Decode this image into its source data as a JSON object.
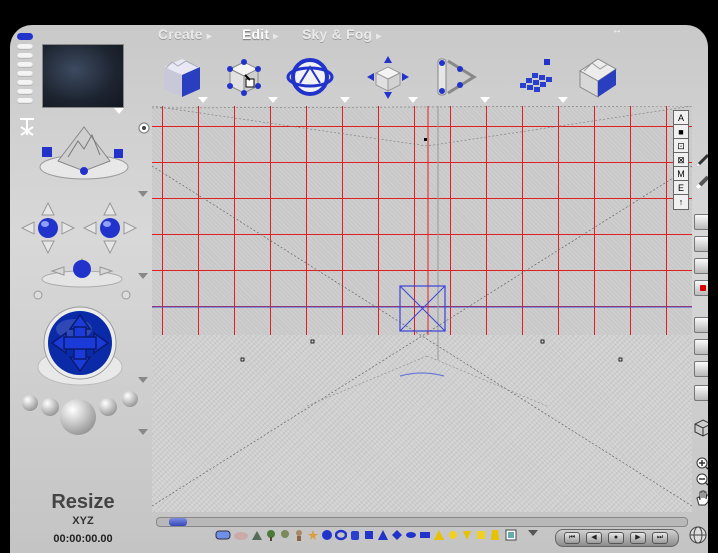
{
  "menus": [
    {
      "label": "Create",
      "arrow": "▸",
      "active": false
    },
    {
      "label": "Edit",
      "arrow": "▸",
      "active": true
    },
    {
      "label": "Sky & Fog",
      "arrow": "▸",
      "active": false
    }
  ],
  "window_resize_glyph": "↔",
  "toolbar_icons": [
    "terrain-cube-icon",
    "select-cube-icon",
    "orbit-sphere-icon",
    "move-cube-icon",
    "camera-path-icon",
    "blue-blocks-icon",
    "rock-cube-icon"
  ],
  "right_toolbar": [
    "A",
    "■",
    "⊡",
    "⊠",
    "M",
    "E",
    "↑"
  ],
  "mode": {
    "title": "Resize",
    "subtitle": "XYZ",
    "timecode": "00:00:00.00"
  },
  "playback_buttons": [
    "⏮",
    "◀",
    "●",
    "▶",
    "⏭"
  ],
  "colors": {
    "grid_red": "#e02020",
    "accent_blue": "#2233cc",
    "panel_gray": "#d0d0d0"
  }
}
